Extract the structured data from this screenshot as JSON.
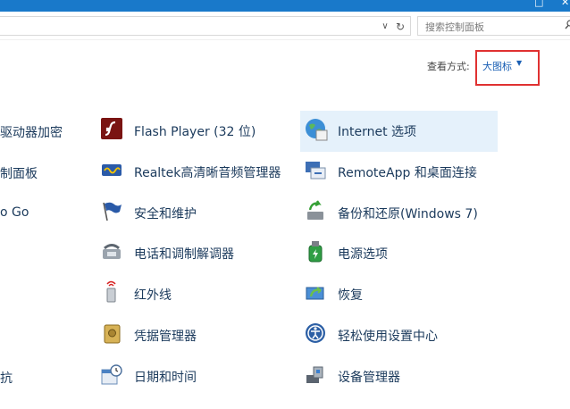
{
  "window": {
    "min_glyph": "—",
    "max_glyph": "□",
    "close_glyph": "✕"
  },
  "address": {
    "chevron": "∨",
    "refresh": "↻"
  },
  "search": {
    "placeholder": "搜索控制面板",
    "icon": "search-icon"
  },
  "view": {
    "label": "查看方式:",
    "value": "大图标",
    "caret": "▼",
    "highlight_color": "#e03131"
  },
  "left_column_clipped": [
    "驱动器加密",
    "制面板",
    "o Go",
    "抗"
  ],
  "items_col2": [
    {
      "label": "Flash Player (32 位)",
      "icon": "flash-player-icon"
    },
    {
      "label": "Realtek高清晰音频管理器",
      "icon": "realtek-audio-icon"
    },
    {
      "label": "安全和维护",
      "icon": "security-flag-icon"
    },
    {
      "label": "电话和调制解调器",
      "icon": "phone-modem-icon"
    },
    {
      "label": "红外线",
      "icon": "infrared-icon"
    },
    {
      "label": "凭据管理器",
      "icon": "credential-vault-icon"
    },
    {
      "label": "日期和时间",
      "icon": "calendar-clock-icon"
    }
  ],
  "items_col3": [
    {
      "label": "Internet 选项",
      "icon": "internet-globe-icon"
    },
    {
      "label": "RemoteApp 和桌面连接",
      "icon": "remoteapp-icon"
    },
    {
      "label": "备份和还原(Windows 7)",
      "icon": "backup-restore-icon"
    },
    {
      "label": "电源选项",
      "icon": "power-options-icon"
    },
    {
      "label": "恢复",
      "icon": "recovery-icon"
    },
    {
      "label": "轻松使用设置中心",
      "icon": "ease-of-access-icon"
    },
    {
      "label": "设备管理器",
      "icon": "device-manager-icon"
    }
  ],
  "colors": {
    "titlebar": "#1979ca",
    "link_text": "#1b3a5c",
    "selection": "#e5f1fb"
  }
}
